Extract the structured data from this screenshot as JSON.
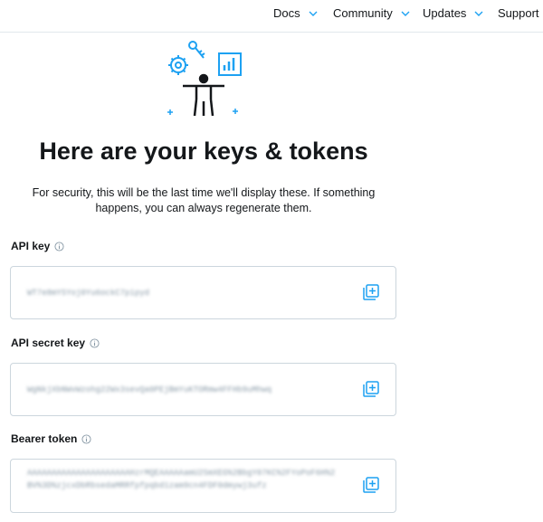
{
  "nav": {
    "items": [
      {
        "label": "Docs",
        "has_dropdown": true
      },
      {
        "label": "Community",
        "has_dropdown": true
      },
      {
        "label": "Updates",
        "has_dropdown": true
      },
      {
        "label": "Support",
        "has_dropdown": false
      }
    ]
  },
  "hero": {
    "illustration": "developer-keys-illustration"
  },
  "heading": {
    "title": "Here are your keys & tokens",
    "subtitle": "For security, this will be the last time we'll display these. If something happens, you can always regenerate them."
  },
  "fields": [
    {
      "label": "API key",
      "value": "WT7e8mYSYoj0Yu6ockC7pipyd"
    },
    {
      "label": "API secret key",
      "value": "WgNkjXbNWvWzohg22Wx3sevQa0PEjBmYuKTORmw4FFHb9uMhwq"
    },
    {
      "label": "Bearer token",
      "value": "AAAAAAAAAAAAAAAAAAAAAHzrMQEAAAAAamU2SmXEG%2BbgY07KC%2FYoPoF6H%2BV%3D%zjcxDbRbsedaMRRfpfpqbd1zam9cn4FDF0dmywj3ufz"
    }
  ],
  "icons": {
    "copy": "copy-icon",
    "info": "info-icon",
    "chevron": "chevron-down-icon"
  },
  "colors": {
    "accent": "#1da1f2",
    "text": "#14171a",
    "border": "#ccd6dd"
  }
}
